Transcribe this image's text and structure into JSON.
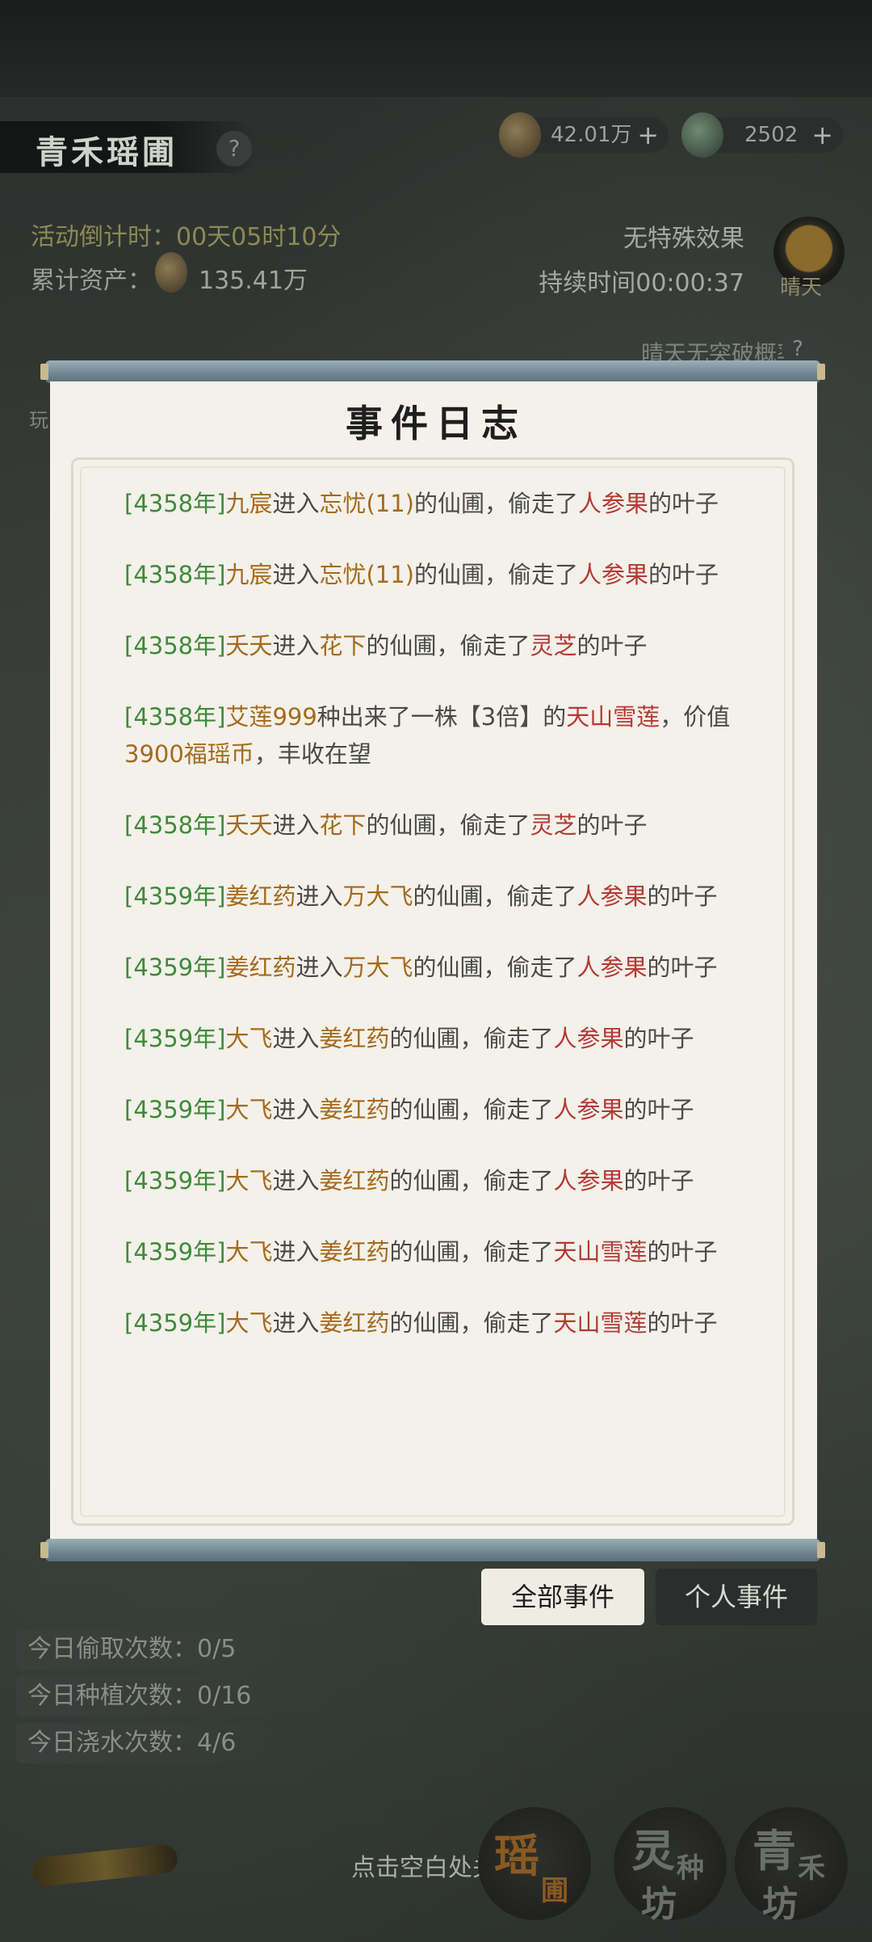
{
  "header": {
    "title": "青禾瑶圃",
    "help_symbol": "?",
    "resources": [
      {
        "icon": "gourd-coin-icon",
        "value": "42.01万",
        "plus": "+"
      },
      {
        "icon": "jade-coin-icon",
        "value": "2502",
        "plus": "+"
      }
    ]
  },
  "info": {
    "countdown": "活动倒计时：00天05时10分",
    "assets_label": "累计资产：",
    "assets_value": "135.41万",
    "effect": "无特殊效果",
    "duration": "持续时间00:00:37",
    "weather": "晴天",
    "breakthrough": "晴天无突破概率",
    "side_label": "玩"
  },
  "modal": {
    "title": "事件日志",
    "entries": [
      {
        "year": "[4358年]",
        "parts": [
          [
            "actor",
            "九宸"
          ],
          [
            "text",
            "进入"
          ],
          [
            "actor",
            "忘忧(11)"
          ],
          [
            "text",
            "的仙圃，偷走了"
          ],
          [
            "plant",
            "人参果"
          ],
          [
            "text",
            "的叶子"
          ]
        ]
      },
      {
        "year": "[4358年]",
        "parts": [
          [
            "actor",
            "九宸"
          ],
          [
            "text",
            "进入"
          ],
          [
            "actor",
            "忘忧(11)"
          ],
          [
            "text",
            "的仙圃，偷走了"
          ],
          [
            "plant",
            "人参果"
          ],
          [
            "text",
            "的叶子"
          ]
        ]
      },
      {
        "year": "[4358年]",
        "parts": [
          [
            "actor",
            "夭夭"
          ],
          [
            "text",
            "进入"
          ],
          [
            "actor",
            "花下"
          ],
          [
            "text",
            "的仙圃，偷走了"
          ],
          [
            "plant",
            "灵芝"
          ],
          [
            "text",
            "的叶子"
          ]
        ]
      },
      {
        "year": "[4358年]",
        "parts": [
          [
            "actor",
            "艾莲999"
          ],
          [
            "text",
            "种出来了一株【3倍】的"
          ],
          [
            "plant",
            "天山雪莲"
          ],
          [
            "text",
            "，价值"
          ],
          [
            "num",
            "3900福瑶币"
          ],
          [
            "text",
            "，丰收在望"
          ]
        ]
      },
      {
        "year": "[4358年]",
        "parts": [
          [
            "actor",
            "夭夭"
          ],
          [
            "text",
            "进入"
          ],
          [
            "actor",
            "花下"
          ],
          [
            "text",
            "的仙圃，偷走了"
          ],
          [
            "plant",
            "灵芝"
          ],
          [
            "text",
            "的叶子"
          ]
        ]
      },
      {
        "year": "[4359年]",
        "parts": [
          [
            "actor",
            "姜红药"
          ],
          [
            "text",
            "进入"
          ],
          [
            "actor",
            "万大飞"
          ],
          [
            "text",
            "的仙圃，偷走了"
          ],
          [
            "plant",
            "人参果"
          ],
          [
            "text",
            "的叶子"
          ]
        ]
      },
      {
        "year": "[4359年]",
        "parts": [
          [
            "actor",
            "姜红药"
          ],
          [
            "text",
            "进入"
          ],
          [
            "actor",
            "万大飞"
          ],
          [
            "text",
            "的仙圃，偷走了"
          ],
          [
            "plant",
            "人参果"
          ],
          [
            "text",
            "的叶子"
          ]
        ]
      },
      {
        "year": "[4359年]",
        "parts": [
          [
            "actor",
            "大飞"
          ],
          [
            "text",
            "进入"
          ],
          [
            "actor",
            "姜红药"
          ],
          [
            "text",
            "的仙圃，偷走了"
          ],
          [
            "plant",
            "人参果"
          ],
          [
            "text",
            "的叶子"
          ]
        ]
      },
      {
        "year": "[4359年]",
        "parts": [
          [
            "actor",
            "大飞"
          ],
          [
            "text",
            "进入"
          ],
          [
            "actor",
            "姜红药"
          ],
          [
            "text",
            "的仙圃，偷走了"
          ],
          [
            "plant",
            "人参果"
          ],
          [
            "text",
            "的叶子"
          ]
        ]
      },
      {
        "year": "[4359年]",
        "parts": [
          [
            "actor",
            "大飞"
          ],
          [
            "text",
            "进入"
          ],
          [
            "actor",
            "姜红药"
          ],
          [
            "text",
            "的仙圃，偷走了"
          ],
          [
            "plant",
            "人参果"
          ],
          [
            "text",
            "的叶子"
          ]
        ]
      },
      {
        "year": "[4359年]",
        "parts": [
          [
            "actor",
            "大飞"
          ],
          [
            "text",
            "进入"
          ],
          [
            "actor",
            "姜红药"
          ],
          [
            "text",
            "的仙圃，偷走了"
          ],
          [
            "plant",
            "天山雪莲"
          ],
          [
            "text",
            "的叶子"
          ]
        ]
      },
      {
        "year": "[4359年]",
        "parts": [
          [
            "actor",
            "大飞"
          ],
          [
            "text",
            "进入"
          ],
          [
            "actor",
            "姜红药"
          ],
          [
            "text",
            "的仙圃，偷走了"
          ],
          [
            "plant",
            "天山雪莲"
          ],
          [
            "text",
            "的叶子"
          ]
        ]
      }
    ],
    "tabs": {
      "all": "全部事件",
      "personal": "个人事件"
    }
  },
  "stats": [
    "今日偷取次数：0/5",
    "今日种植次数：0/16",
    "今日浇水次数：4/6"
  ],
  "close_hint": "点击空白处关闭",
  "nav": [
    {
      "chars": [
        "瑶",
        "圃"
      ]
    },
    {
      "chars": [
        "灵",
        "种",
        "坊"
      ]
    },
    {
      "chars": [
        "青",
        "禾",
        "坊"
      ]
    }
  ]
}
